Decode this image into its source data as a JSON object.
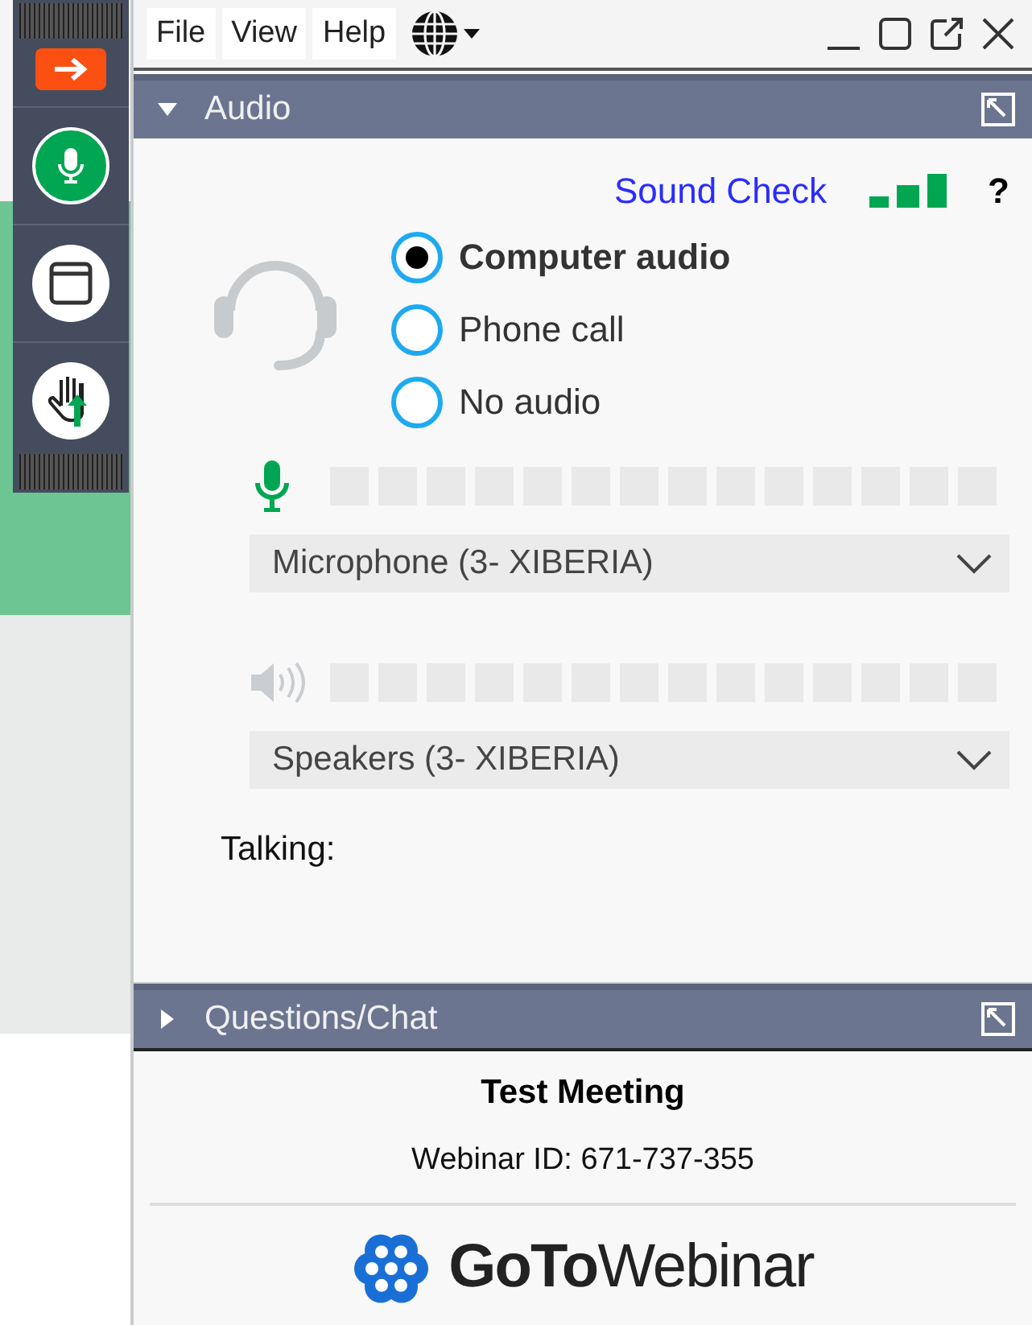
{
  "menu": [
    "File",
    "View",
    "Help"
  ],
  "audio_panel": {
    "title": "Audio",
    "expanded": true,
    "sound_check": "Sound Check",
    "help": "?",
    "options": [
      {
        "label": "Computer audio",
        "selected": true
      },
      {
        "label": "Phone call",
        "selected": false
      },
      {
        "label": "No audio",
        "selected": false
      }
    ],
    "devices": [
      {
        "kind": "microphone",
        "value": "Microphone (3- XIBERIA)"
      },
      {
        "kind": "speaker",
        "value": "Speakers (3- XIBERIA)"
      }
    ],
    "talking": "Talking:"
  },
  "chat_panel": {
    "title": "Questions/Chat",
    "expanded": false
  },
  "meeting": {
    "title": "Test Meeting",
    "webinar_id": "Webinar ID: 671-737-355",
    "brand": "**GoTo**Webinar"
  }
}
